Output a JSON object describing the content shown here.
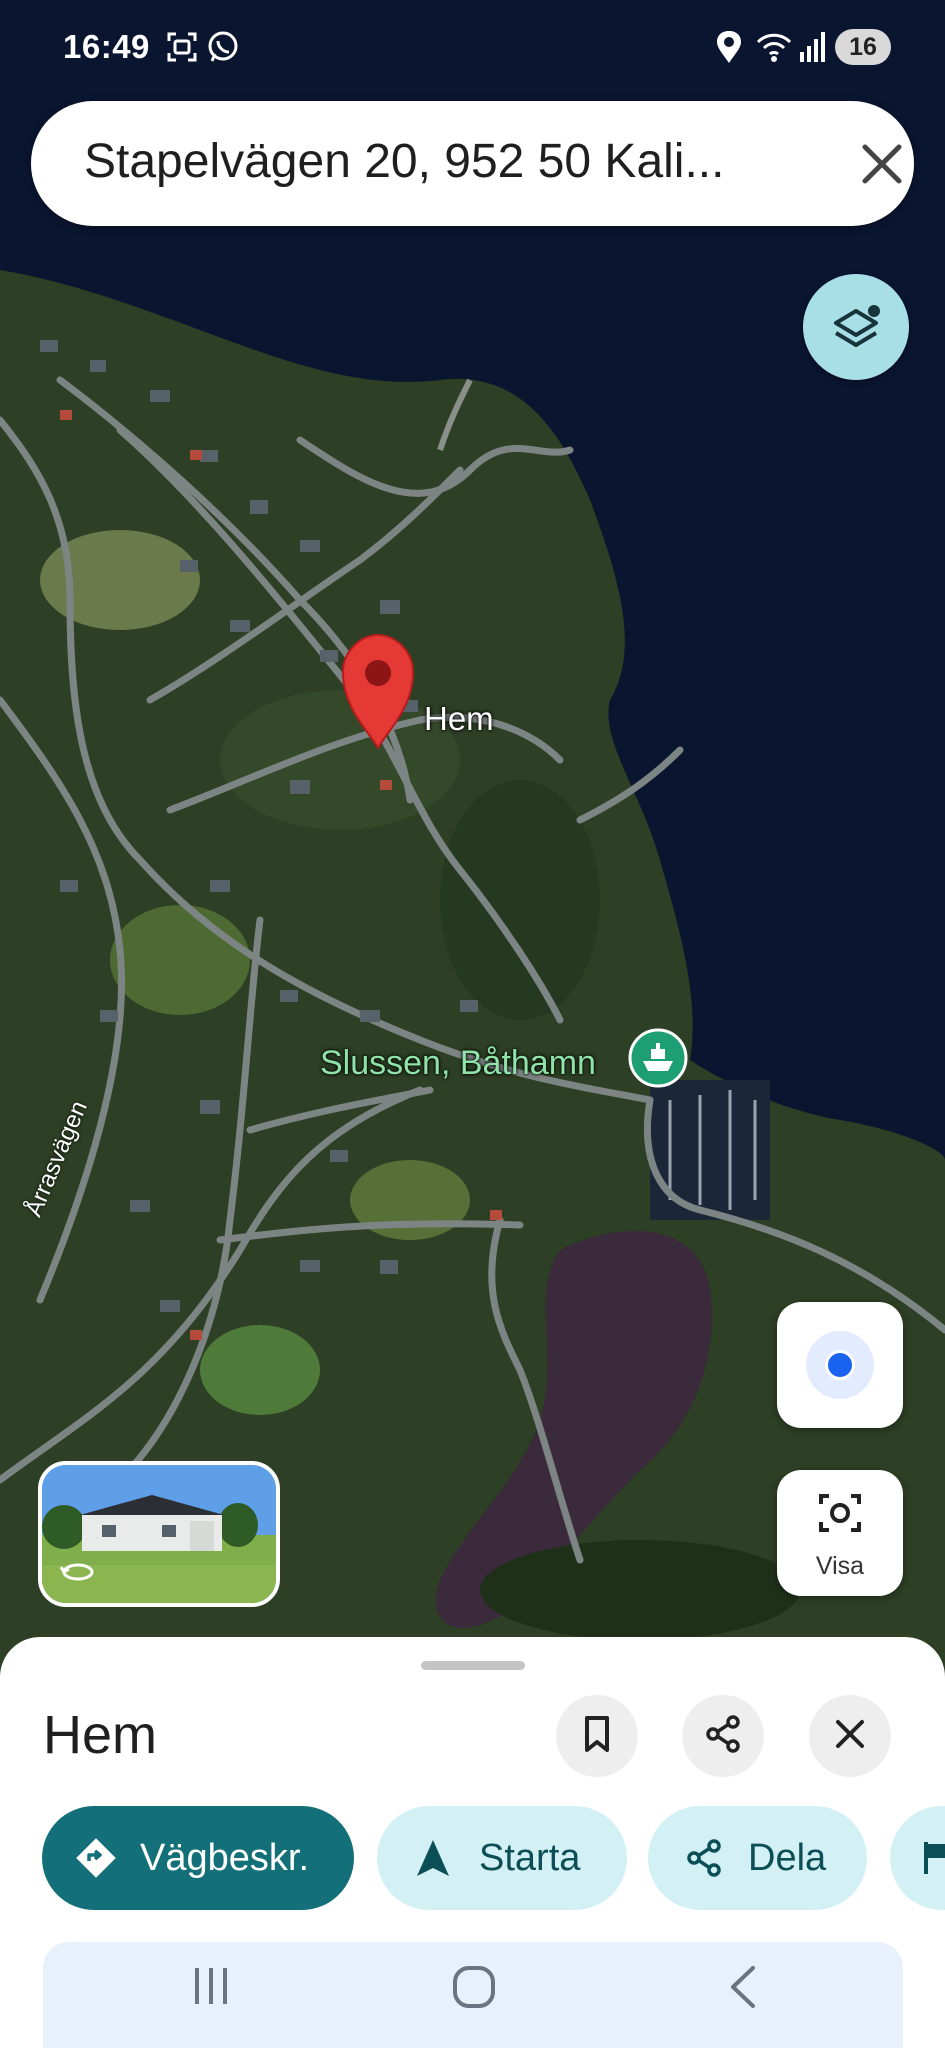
{
  "status_bar": {
    "time": "16:49",
    "battery": "16",
    "icons": [
      "screenshot-icon",
      "whatsapp-icon",
      "location-icon",
      "wifi-icon",
      "signal-icon"
    ]
  },
  "search": {
    "query": "Stapelvägen 20, 952 50 Kali..."
  },
  "map": {
    "place_label": "Hem",
    "poi_label": "Slussen, Båthamn",
    "road_label": "Årrasvägen",
    "location_button": "my-location",
    "lens_label": "Visa"
  },
  "sheet": {
    "title": "Hem",
    "actions": {
      "directions": "Vägbeskr.",
      "start": "Starta",
      "share": "Dela"
    }
  },
  "colors": {
    "primary": "#137078",
    "chip": "#d3f1f5",
    "pin": "#e53935",
    "location_dot": "#1a62f0"
  }
}
